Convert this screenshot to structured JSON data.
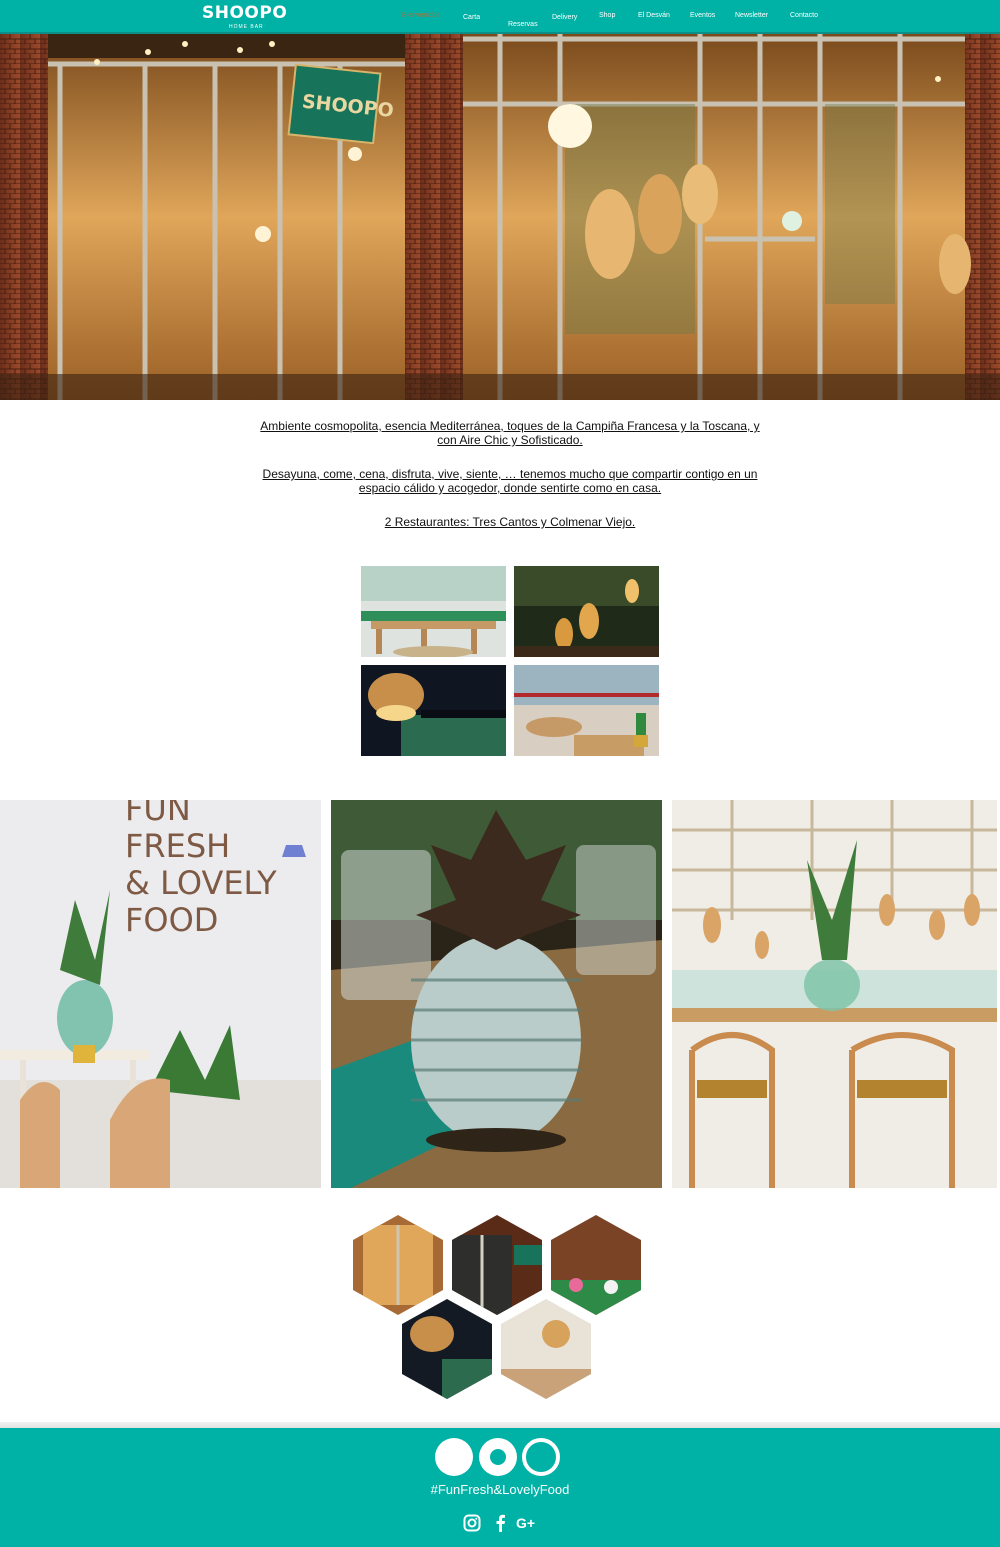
{
  "header": {
    "logo": "SHOOPO",
    "logo_sub": "HOME BAR",
    "nav": [
      "Bienvenidos",
      "Carta",
      "Reservas",
      "Delivery",
      "Shop",
      "El Desván",
      "Eventos",
      "Newsletter",
      "Contacto"
    ]
  },
  "intro": {
    "p1": "Ambiente cosmopolita, esencia Mediterránea, toques de la Campiña Francesa y la Toscana, y con Aire Chic y Sofisticado.",
    "p2": "Desayuna, come, cena, disfruta, vive, siente, … tenemos mucho que compartir contigo en un espacio cálido y acogedor, donde sentirte como en casa.",
    "p3": "2 Restaurantes: Tres Cantos y Colmenar Viejo."
  },
  "panels": {
    "neon_text": [
      "FUN",
      "FRESH",
      "& LOVELY",
      "FOOD"
    ]
  },
  "footer": {
    "tagline": "#FunFresh&LovelyFood",
    "social": [
      "instagram-icon",
      "facebook-icon",
      "google-plus-icon"
    ],
    "gplus_label": "G+"
  },
  "colors": {
    "brand": "#00b2a6",
    "active_nav": "#a2723c"
  }
}
